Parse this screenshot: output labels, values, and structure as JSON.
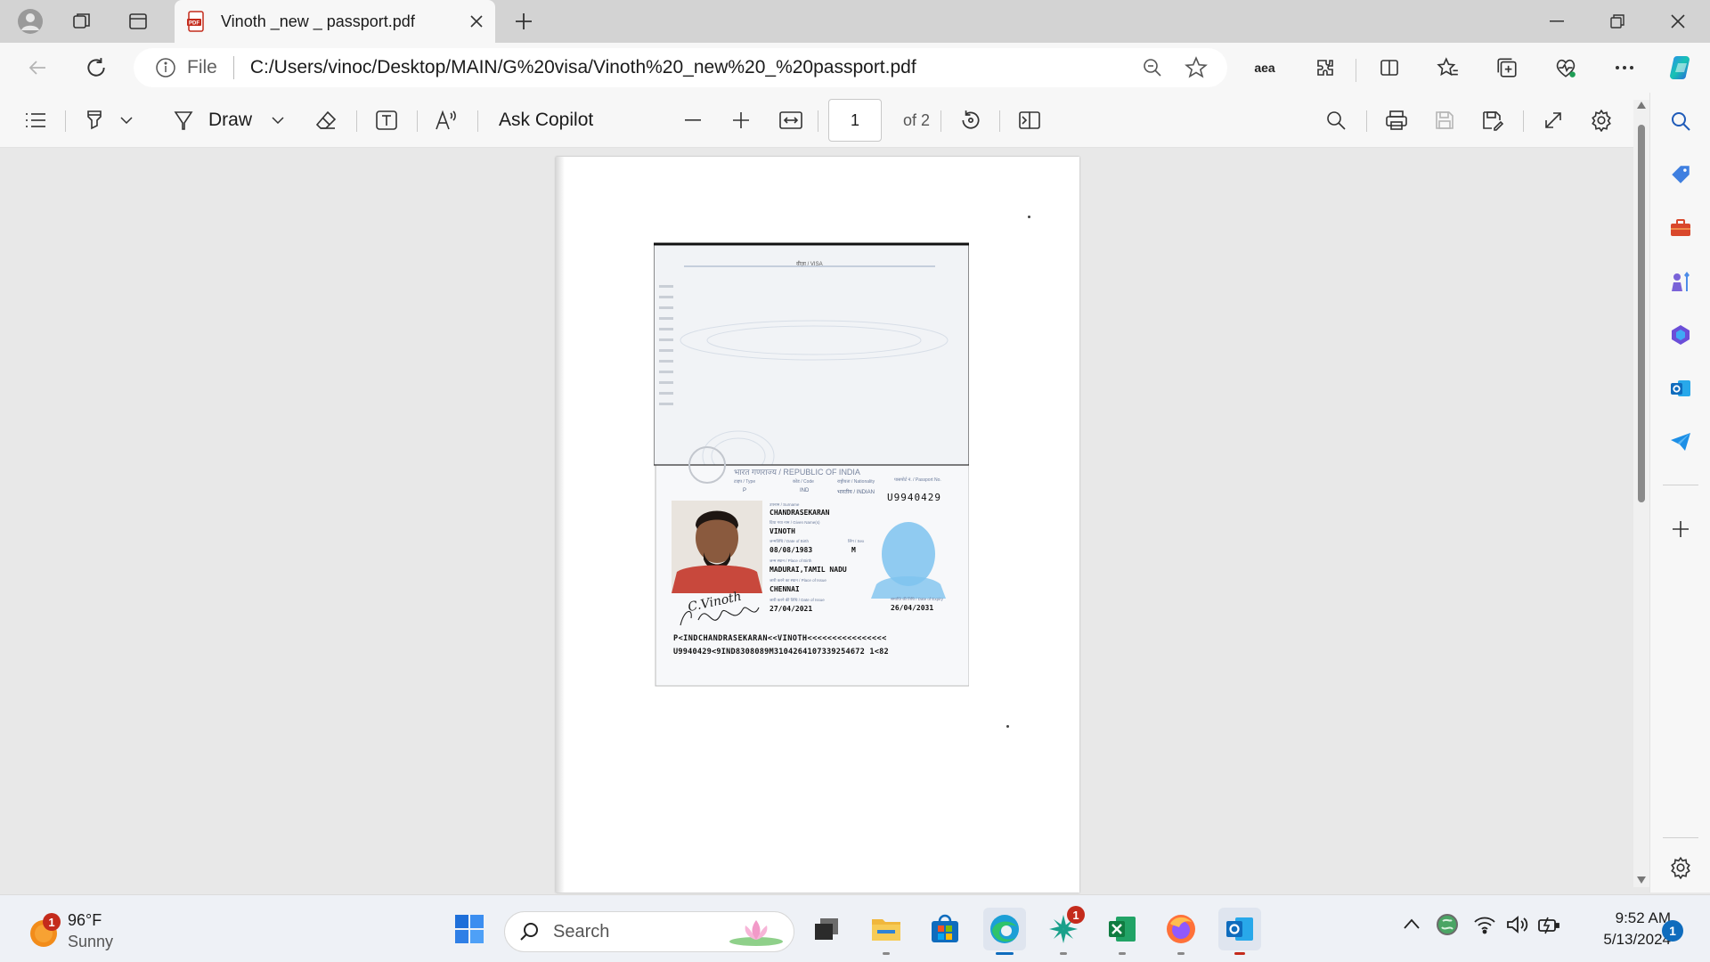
{
  "browser": {
    "tab": {
      "title": "Vinoth _new _ passport.pdf"
    },
    "address": {
      "scheme_label": "File",
      "url": "C:/Users/vinoc/Desktop/MAIN/G%20visa/Vinoth%20_new%20_%20passport.pdf"
    },
    "extension_label": "aea"
  },
  "pdf_toolbar": {
    "draw_label": "Draw",
    "ask_copilot_label": "Ask Copilot",
    "current_page": "1",
    "page_total": "of 2"
  },
  "passport": {
    "visa_header": "वीज़ा / VISA",
    "republic": "भारत गणराज्य / REPUBLIC OF INDIA",
    "type_label": "टाइप / Type",
    "type_value": "P",
    "code_label": "कोड / Code",
    "code_value": "IND",
    "nationality_label": "राष्ट्रीयता / Nationality",
    "nationality_value": "भारतीय / INDIAN",
    "passport_no_label": "पासपोर्ट नं. / Passport No.",
    "passport_no": "U9940429",
    "surname_label": "उपनाम / Surname",
    "surname": "CHANDRASEKARAN",
    "given_label": "दिया गया नाम / Given Name(s)",
    "given_name": "VINOTH",
    "dob_label": "जन्मतिथि / Date of Birth",
    "dob": "08/08/1983",
    "sex_label": "लिंग / Sex",
    "sex": "M",
    "pob_label": "जन्म स्थान / Place of Birth",
    "pob": "MADURAI,TAMIL NADU",
    "poi_label": "जारी करने का स्थान / Place of Issue",
    "poi": "CHENNAI",
    "doi_label": "जारी करने की तिथि / Date of Issue",
    "doi": "27/04/2021",
    "doe_label": "समाप्ति की तिथि / Date of Expiry",
    "doe": "26/04/2031",
    "signature": "C.Vinoth",
    "mrz_line1": "P<INDCHANDRASEKARAN<<VINOTH<<<<<<<<<<<<<<<<",
    "mrz_line2": "U9940429<9IND8308089M3104264107339254672 1<82"
  },
  "taskbar": {
    "weather": {
      "temp": "96°F",
      "condition": "Sunny",
      "badge": "1"
    },
    "search_placeholder": "Search",
    "copilot_badge": "1",
    "clock": {
      "time": "9:52 AM",
      "date": "5/13/2024"
    },
    "notification_count": "1"
  },
  "colors": {
    "edge_accent": "#0f6cbd",
    "badge_red": "#c42b1c",
    "passport_blue": "#6fb8e8"
  }
}
